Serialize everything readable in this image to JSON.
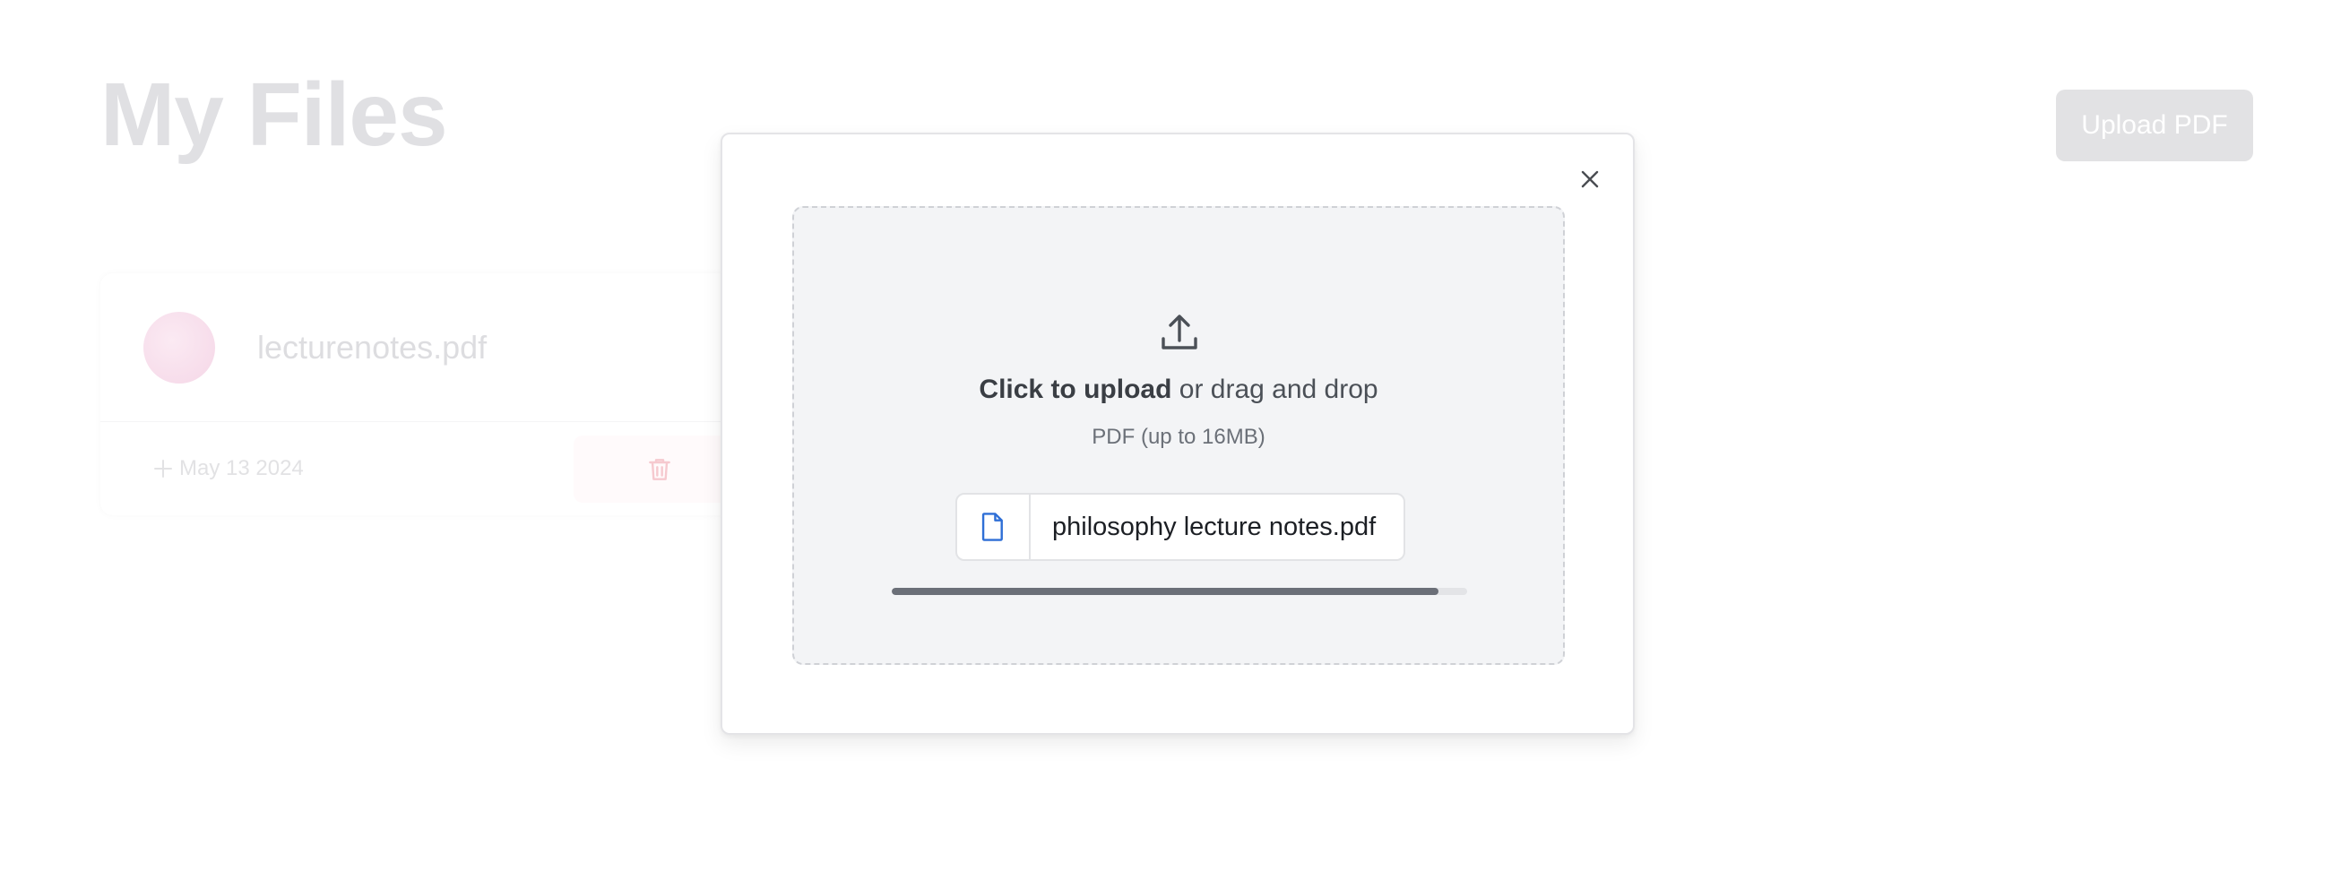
{
  "page": {
    "title": "My Files",
    "upload_button_label": "Upload PDF"
  },
  "files": [
    {
      "name": "lecturenotes.pdf",
      "date": "May 13 2024"
    }
  ],
  "modal": {
    "dropzone": {
      "click_text": "Click to upload",
      "drag_text": " or drag and drop",
      "hint": "PDF (up to 16MB)"
    },
    "selected_file": {
      "name": "philosophy lecture notes.pdf",
      "icon": "file-icon"
    },
    "upload_progress": 0.95
  },
  "colors": {
    "file_icon": "#2f6fd6",
    "progress_fill": "#6b6f78",
    "delete_icon": "#f6c9cf"
  }
}
